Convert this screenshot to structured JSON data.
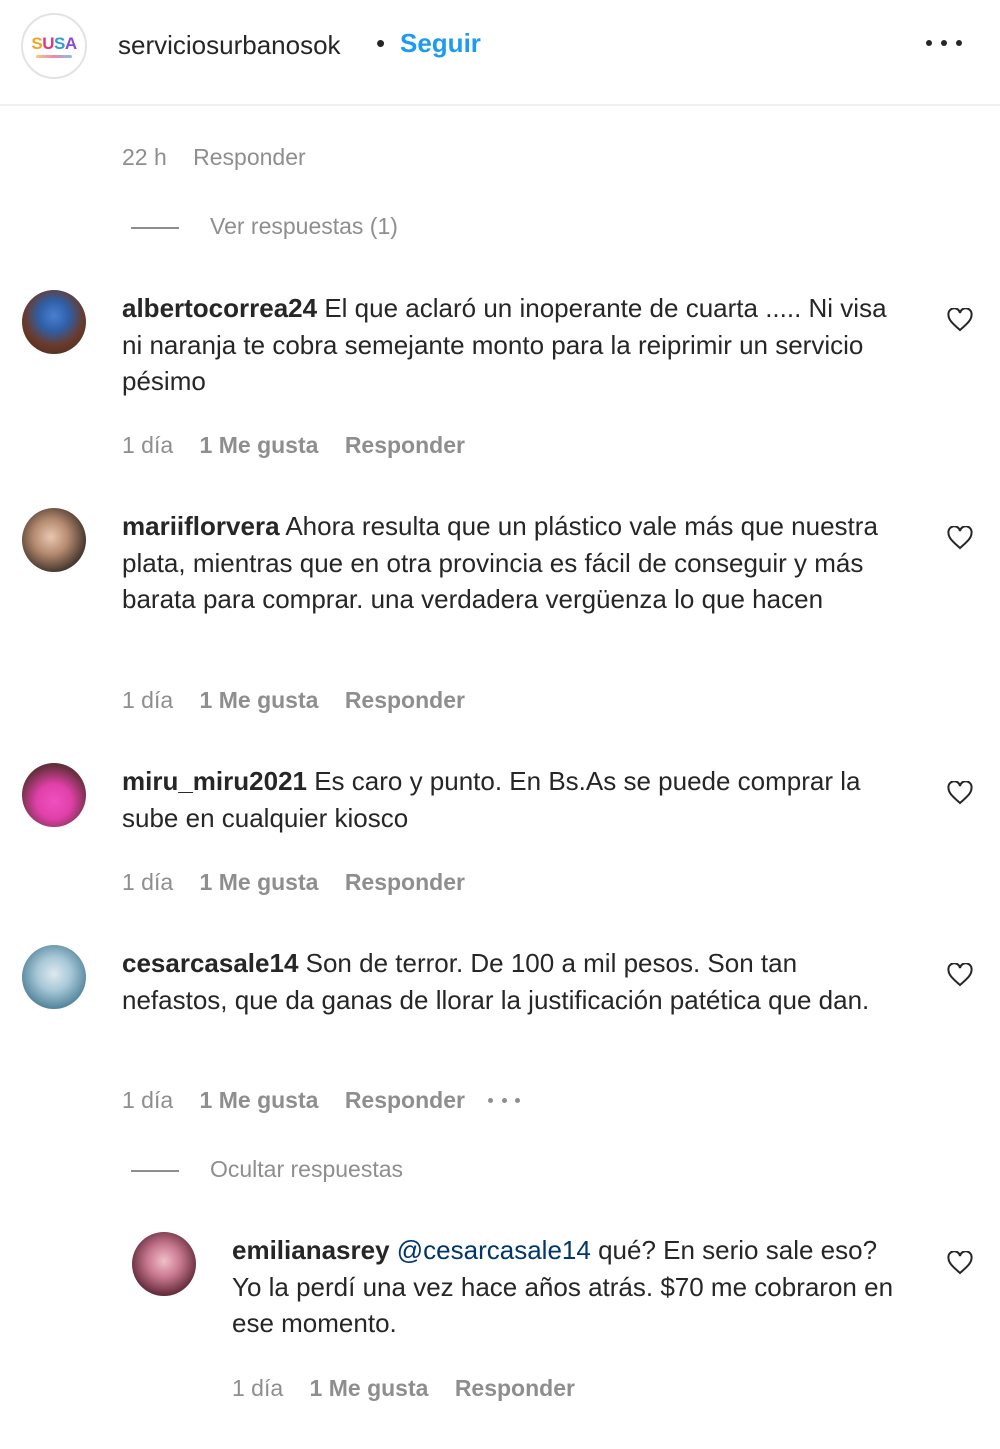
{
  "header": {
    "logo_text": "SUSA",
    "username": "serviciosurbanosok",
    "separator": "•",
    "follow_label": "Seguir"
  },
  "top": {
    "time": "22 h",
    "reply_label": "Responder",
    "view_replies": "Ver respuestas (1)"
  },
  "comments": [
    {
      "username": "albertocorrea24",
      "text": " El que aclaró un inoperante de cuarta ..... Ni visa ni naranja te cobra semejante monto para la reiprimir un servicio pésimo",
      "time": "1 día",
      "likes": "1 Me gusta",
      "reply_label": "Responder"
    },
    {
      "username": "mariiflorvera",
      "text": " Ahora resulta que un plástico vale más que nuestra plata, mientras que en otra provincia es fácil de conseguir y más barata para comprar. una verdadera vergüenza lo que hacen",
      "time": "1 día",
      "likes": "1 Me gusta",
      "reply_label": "Responder"
    },
    {
      "username": "miru_miru2021",
      "text": " Es caro y punto. En Bs.As se puede comprar la sube en cualquier kiosco",
      "time": "1 día",
      "likes": "1 Me gusta",
      "reply_label": "Responder"
    },
    {
      "username": "cesarcasale14",
      "text": " Son de terror. De 100 a mil pesos. Son tan nefastos, que da ganas de llorar la justificación patética que dan.",
      "time": "1 día",
      "likes": "1 Me gusta",
      "reply_label": "Responder",
      "hide_replies": "Ocultar respuestas"
    }
  ],
  "reply": {
    "username": "emilianasrey",
    "mention": " @cesarcasale14",
    "text": " qué? En serio sale eso? Yo la perdí una vez hace años atrás. $70 me cobraron en ese momento.",
    "time": "1 día",
    "likes": "1 Me gusta",
    "reply_label": "Responder"
  },
  "colors": {
    "follow": "#1d9bf0",
    "muted": "#8e8e8e",
    "text": "#262626"
  }
}
